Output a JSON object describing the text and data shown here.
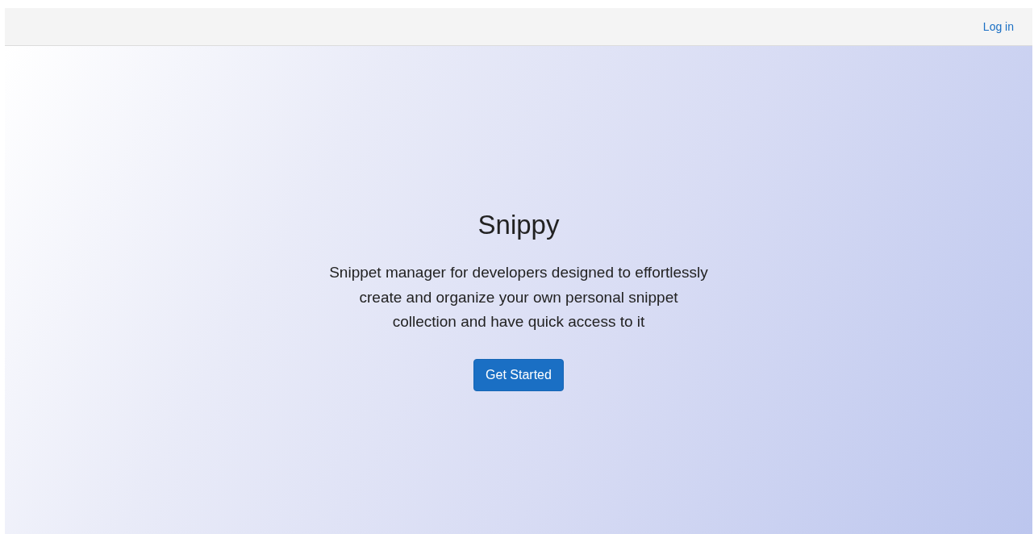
{
  "navbar": {
    "login_link": "Log in"
  },
  "hero": {
    "title": "Snippy",
    "description": "Snippet manager for developers designed to effortlessly create and organize your own personal snippet collection and have quick access to it",
    "button": "Get Started"
  }
}
